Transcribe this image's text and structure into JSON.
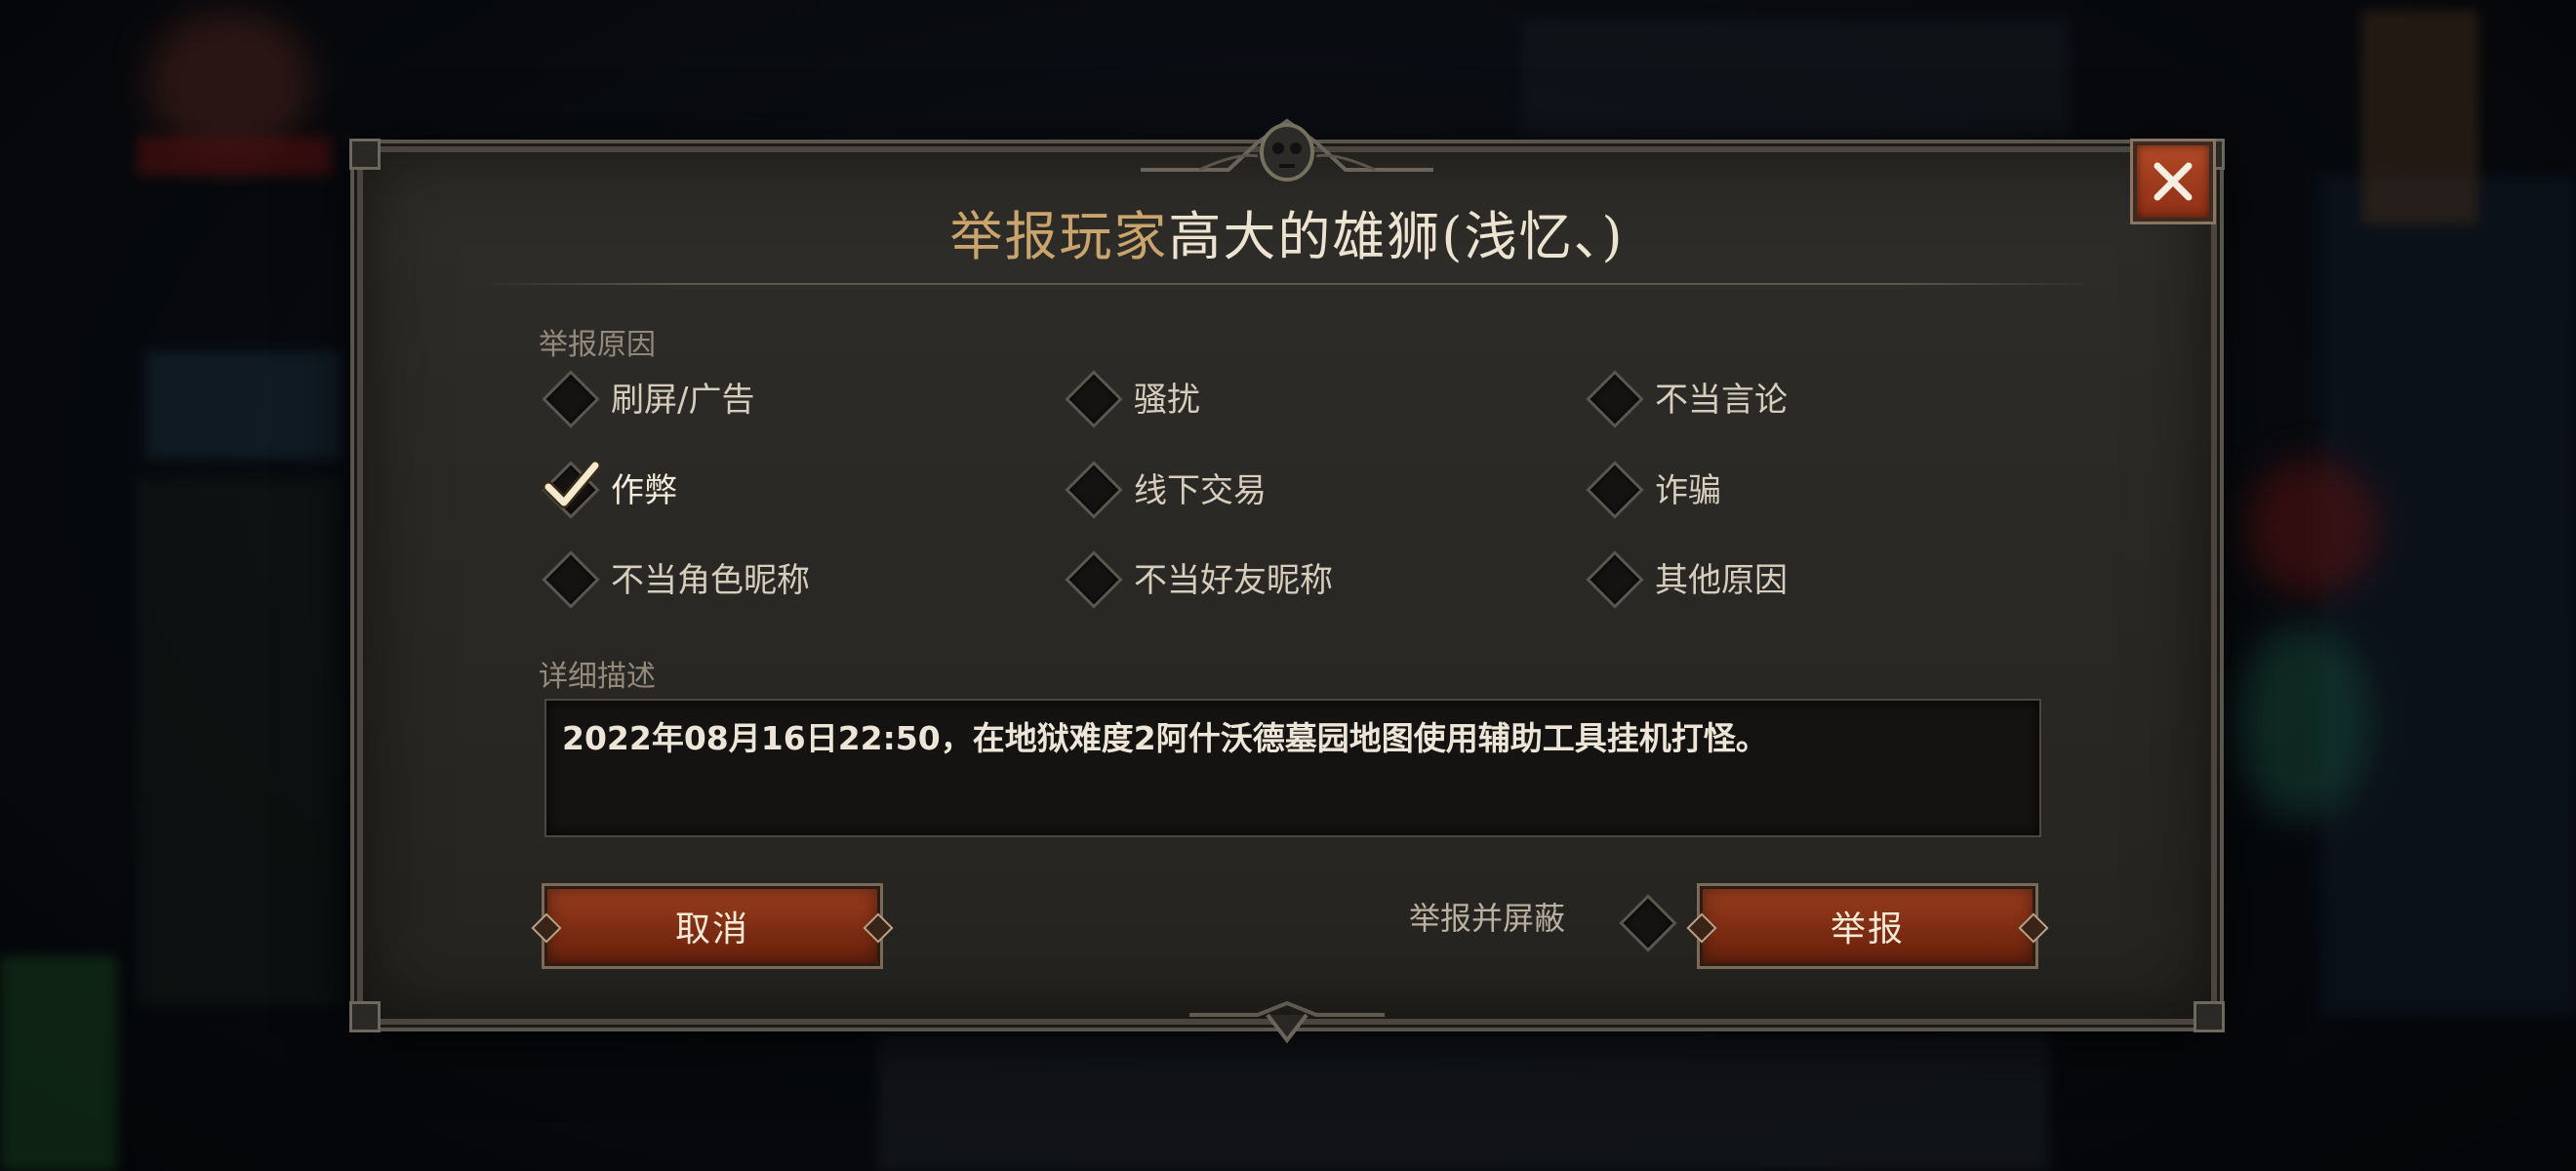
{
  "dialog": {
    "title_prefix": "举报玩家",
    "title_name": "高大的雄狮(浅忆、)",
    "close_icon": "close-icon"
  },
  "reasons": {
    "label": "举报原因",
    "items": [
      {
        "label": "刷屏/广告",
        "checked": false
      },
      {
        "label": "骚扰",
        "checked": false
      },
      {
        "label": "不当言论",
        "checked": false
      },
      {
        "label": "作弊",
        "checked": true
      },
      {
        "label": "线下交易",
        "checked": false
      },
      {
        "label": "诈骗",
        "checked": false
      },
      {
        "label": "不当角色昵称",
        "checked": false
      },
      {
        "label": "不当好友昵称",
        "checked": false
      },
      {
        "label": "其他原因",
        "checked": false
      }
    ]
  },
  "description": {
    "label": "详细描述",
    "value": "2022年08月16日22:50，在地狱难度2阿什沃德墓园地图使用辅助工具挂机打怪。"
  },
  "actions": {
    "cancel_label": "取消",
    "block_label": "举报并屏蔽",
    "block_checked": false,
    "submit_label": "举报"
  },
  "colors": {
    "accent_button": "#8d2f16",
    "title_prefix": "#c9a46c",
    "checkmark": "#f4ead0"
  }
}
